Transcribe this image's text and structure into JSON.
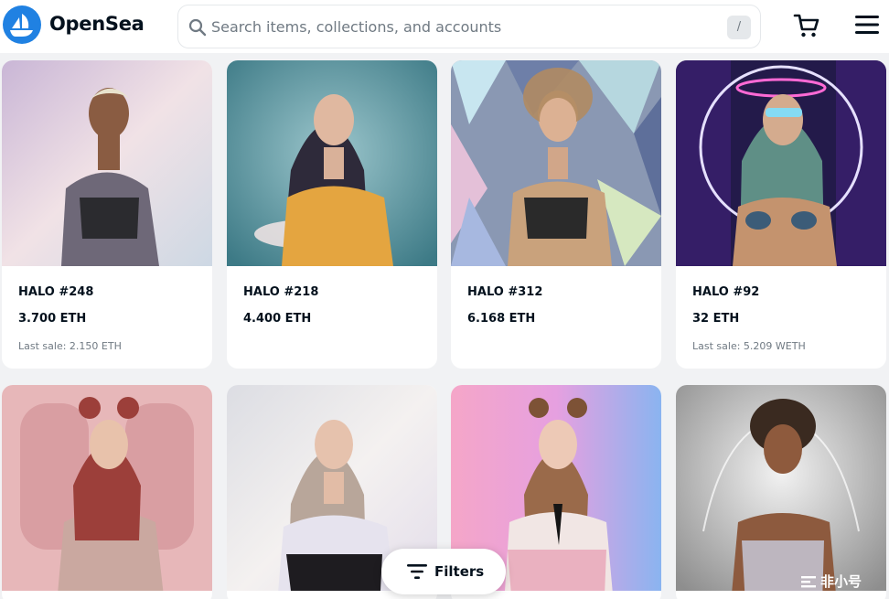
{
  "header": {
    "brand": "OpenSea",
    "search_placeholder": "Search items, collections, and accounts",
    "search_shortcut": "/",
    "icons": [
      "opensea-logo-icon",
      "search-icon",
      "cart-icon",
      "menu-icon"
    ],
    "brand_color": "#2081e2"
  },
  "items": [
    {
      "name": "HALO #248",
      "price": "3.700 ETH",
      "last_sale": "Last sale: 2.150 ETH"
    },
    {
      "name": "HALO #218",
      "price": "4.400 ETH",
      "last_sale": ""
    },
    {
      "name": "HALO #312",
      "price": "6.168 ETH",
      "last_sale": ""
    },
    {
      "name": "HALO #92",
      "price": "32 ETH",
      "last_sale": "Last sale: 5.209 WETH"
    }
  ],
  "filters_button": {
    "label": "Filters",
    "icon": "filter-icon"
  },
  "watermark": {
    "text": "非小号"
  }
}
